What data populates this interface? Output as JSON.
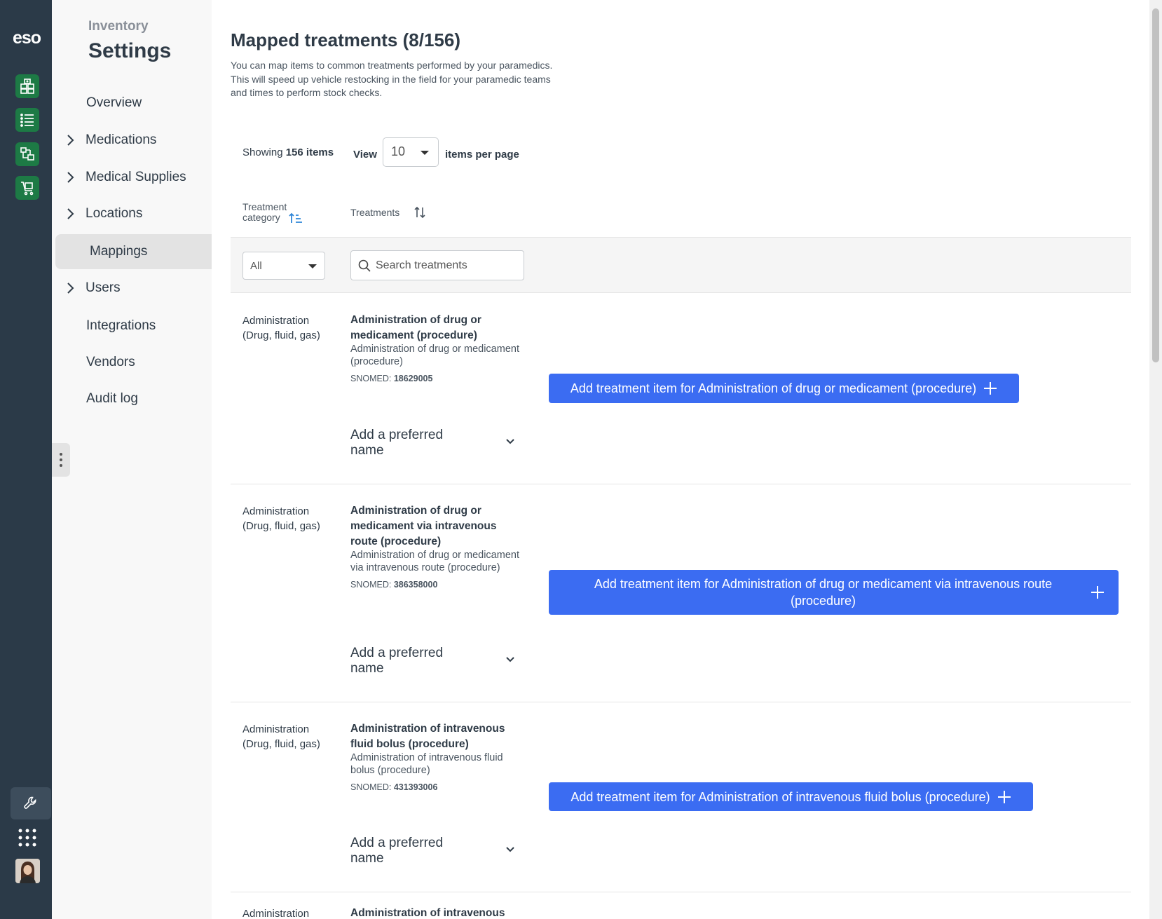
{
  "app": {
    "logo": "eso"
  },
  "nav": {
    "subtitle": "Inventory",
    "title": "Settings",
    "items": [
      {
        "label": "Overview",
        "expandable": false
      },
      {
        "label": "Medications",
        "expandable": true
      },
      {
        "label": "Medical Supplies",
        "expandable": true
      },
      {
        "label": "Locations",
        "expandable": true
      },
      {
        "label": "Mappings",
        "expandable": false,
        "active": true
      },
      {
        "label": "Users",
        "expandable": true
      },
      {
        "label": "Integrations",
        "expandable": false
      },
      {
        "label": "Vendors",
        "expandable": false
      },
      {
        "label": "Audit log",
        "expandable": false
      }
    ]
  },
  "main": {
    "title": "Mapped treatments (8/156)",
    "description": "You can map items to common treatments performed by your paramedics. This will speed up vehicle restocking in the field for your paramedic teams and times to perform stock checks.",
    "paging": {
      "showing_prefix": "Showing",
      "showing_count": "156 items",
      "view_label": "View",
      "per_page_value": "10",
      "per_page_suffix": "items per page"
    },
    "columns": {
      "category": "Treatment category",
      "treatments": "Treatments"
    },
    "filters": {
      "category_value": "All",
      "search_placeholder": "Search treatments"
    },
    "rows": [
      {
        "category": "Administration (Drug, fluid, gas)",
        "name": "Administration of drug or medicament (procedure)",
        "description": "Administration of drug or medicament (procedure)",
        "snomed_label": "SNOMED:",
        "snomed": "18629005",
        "add_label": "Add treatment item for Administration of drug or medicament (procedure)",
        "preferred_label": "Add a preferred name"
      },
      {
        "category": "Administration (Drug, fluid, gas)",
        "name": "Administration of drug or medicament via intravenous route (procedure)",
        "description": "Administration of drug or medicament via intravenous route (procedure)",
        "snomed_label": "SNOMED:",
        "snomed": "386358000",
        "add_label": "Add treatment item for Administration of drug or medicament via intravenous route (procedure)",
        "preferred_label": "Add a preferred name"
      },
      {
        "category": "Administration (Drug, fluid, gas)",
        "name": "Administration of intravenous fluid bolus (procedure)",
        "description": "Administration of intravenous fluid bolus (procedure)",
        "snomed_label": "SNOMED:",
        "snomed": "431393006",
        "add_label": "Add treatment item for Administration of intravenous fluid bolus (procedure)",
        "preferred_label": "Add a preferred name"
      },
      {
        "category": "Administration",
        "name": "Administration of intravenous"
      }
    ]
  },
  "colors": {
    "rail": "#2b3a48",
    "rail_button": "#1d7a45",
    "primary_button": "#3b6cf2",
    "sort_active": "#2f86d8"
  }
}
